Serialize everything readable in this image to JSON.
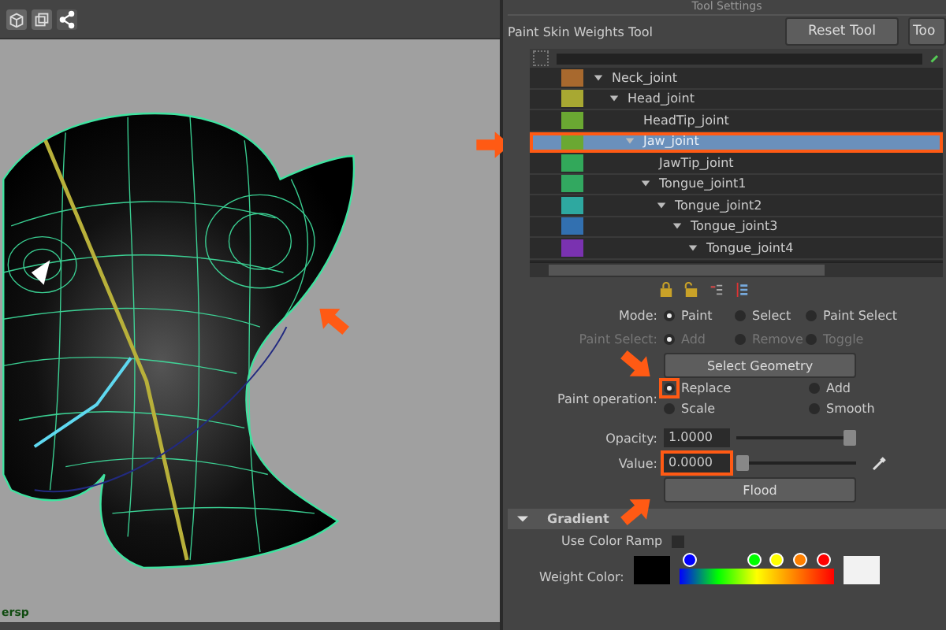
{
  "viewport": {
    "camera_label": "ersp"
  },
  "tool_settings": {
    "title": "Tool Settings",
    "tool_name": "Paint Skin Weights Tool",
    "buttons": [
      "Reset Tool",
      "Too"
    ]
  },
  "influences": [
    {
      "name": "Neck_joint",
      "color": "#a8692e",
      "expanded": true,
      "selected": false,
      "highlighted": false,
      "children": [
        {
          "name": "Head_joint",
          "color": "#a8a832",
          "expanded": true,
          "selected": false,
          "highlighted": false,
          "children": [
            {
              "name": "HeadTip_joint",
              "color": "#6aa832",
              "selected": false,
              "highlighted": false
            },
            {
              "name": "Jaw_joint",
              "color": "#6aa832",
              "expanded": true,
              "selected": true,
              "highlighted": true,
              "children": [
                {
                  "name": "JawTip_joint",
                  "color": "#32a85a",
                  "selected": false,
                  "highlighted": false
                },
                {
                  "name": "Tongue_joint1",
                  "color": "#32a860",
                  "expanded": true,
                  "selected": false,
                  "highlighted": false,
                  "children": [
                    {
                      "name": "Tongue_joint2",
                      "color": "#2ea8a0",
                      "expanded": true,
                      "selected": false,
                      "highlighted": false,
                      "children": [
                        {
                          "name": "Tongue_joint3",
                          "color": "#3270b0",
                          "expanded": true,
                          "selected": false,
                          "highlighted": false,
                          "children": [
                            {
                              "name": "Tongue_joint4",
                              "color": "#7a32b0",
                              "expanded": true,
                              "selected": false,
                              "highlighted": false
                            }
                          ]
                        }
                      ]
                    }
                  ]
                }
              ]
            }
          ]
        }
      ]
    }
  ],
  "mode": {
    "label": "Mode:",
    "disabled": false,
    "options": [
      {
        "label": "Paint",
        "selected": true,
        "highlighted": false
      },
      {
        "label": "Select",
        "selected": false,
        "highlighted": false
      },
      {
        "label": "Paint Select",
        "selected": false,
        "highlighted": false
      }
    ]
  },
  "paint_select": {
    "label": "Paint Select:",
    "disabled": true,
    "options": [
      {
        "label": "Add",
        "selected": true,
        "highlighted": false
      },
      {
        "label": "Remove",
        "selected": false,
        "highlighted": false
      },
      {
        "label": "Toggle",
        "selected": false,
        "highlighted": false
      }
    ]
  },
  "select_geometry_button": "Select Geometry",
  "paint_operation": {
    "label": "Paint operation:",
    "disabled": false,
    "options": [
      {
        "label": "Replace",
        "selected": true,
        "highlighted": true
      },
      {
        "label": "Add",
        "selected": false,
        "highlighted": false
      },
      {
        "label": "Scale",
        "selected": false,
        "highlighted": false
      },
      {
        "label": "Smooth",
        "selected": false,
        "highlighted": false
      }
    ]
  },
  "opacity": {
    "label": "Opacity:",
    "value": "1.0000",
    "level": 1.0,
    "highlighted": false
  },
  "value": {
    "label": "Value:",
    "value": "0.0000",
    "level": 0.0,
    "highlighted": true
  },
  "flood_button": "Flood",
  "gradient": {
    "title": "Gradient",
    "expanded": true,
    "use_color_ramp": {
      "label": "Use Color Ramp",
      "checked": false
    },
    "weight_color_label": "Weight Color:",
    "ramp_markers": [
      {
        "color": "#0000ff"
      },
      {
        "color": "#00ff00"
      },
      {
        "color": "#ffff00"
      },
      {
        "color": "#ff8000"
      },
      {
        "color": "#ff0000"
      }
    ]
  }
}
